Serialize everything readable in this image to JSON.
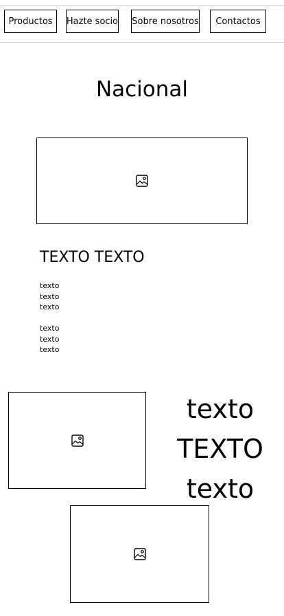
{
  "nav": {
    "items": [
      "Productos",
      "Hazte socio",
      "Sobre nosotros",
      "Contactos"
    ]
  },
  "main": {
    "title": "Nacional",
    "subtitle": "TEXTO TEXTO",
    "paragraph_1": [
      "texto",
      "texto",
      "texto"
    ],
    "paragraph_2": [
      "texto",
      "texto",
      "texto"
    ],
    "feature_text": [
      "texto",
      "TEXTO",
      "texto"
    ]
  },
  "icons": {
    "image_placeholder": "image-icon"
  }
}
